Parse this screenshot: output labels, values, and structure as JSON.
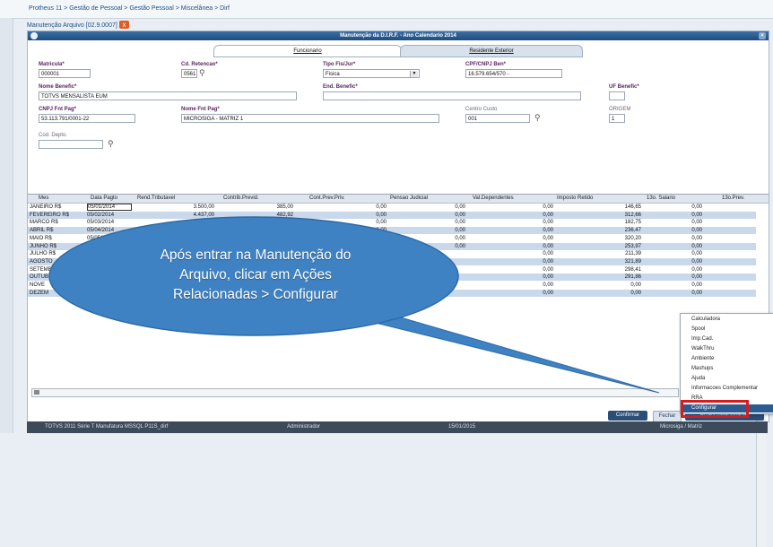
{
  "breadcrumb": "Protheus 11 > Gestão de Pessoal > Gestão Pessoal > Miscelânea > Dirf",
  "page_title": "Manutenção Arquivo [02.9.0007]",
  "close_label": "x",
  "window_title": "Manutenção da D.I.R.F. - Ano Calendario 2014",
  "tabs": [
    "Funcionario",
    "Residente Exterior"
  ],
  "fields": {
    "matricula": {
      "label": "Matricula*",
      "value": "000001"
    },
    "cd_retencao": {
      "label": "Cd. Retencao*",
      "value": "0561"
    },
    "tipo_fis_jur": {
      "label": "Tipo Fis/Jur*",
      "value": "Fisica"
    },
    "cpf_cnpj": {
      "label": "CPF/CNPJ Ben*",
      "value": "16.579.654/570 -"
    },
    "nome_benefic": {
      "label": "Nome Benefic*",
      "value": "TOTVS MENSALISTA EUM"
    },
    "end_benefic": {
      "label": "End. Benefic*",
      "value": ""
    },
    "uf_benefic": {
      "label": "UF Benefic*",
      "value": ""
    },
    "cnpj_fnt_pag": {
      "label": "CNPJ Fnt Pag*",
      "value": "53.113.791/0001-22"
    },
    "nome_fnt_pag": {
      "label": "Nome Fnt Pag*",
      "value": "MICROSIGA - MATRIZ 1"
    },
    "centro_custo": {
      "label": "Centro Custo",
      "value": "001"
    },
    "origem": {
      "label": "ORIGEM",
      "value": "1"
    },
    "cod_depto": {
      "label": "Cod. Depto.",
      "value": ""
    }
  },
  "grid": {
    "columns": [
      "Mes",
      "Data Pagto",
      "Rend.Tributavel",
      "Contrib.Previd.",
      "Cont.Prev.Priv.",
      "Pensao Judicial",
      "Val.Dependentes",
      "Imposto Retido",
      "13o. Salario",
      "13o.Prev."
    ],
    "rows": [
      [
        "JANEIRO  R$",
        "05/01/2014",
        "3.500,00",
        "385,00",
        "0,00",
        "0,00",
        "0,00",
        "146,65",
        "0,00"
      ],
      [
        "FEVEREIRO R$",
        "05/02/2014",
        "4.437,00",
        "482,92",
        "0,00",
        "0,00",
        "0,00",
        "312,66",
        "0,00"
      ],
      [
        "MARCO  R$",
        "05/03/2014",
        "3.770,42",
        "414,74",
        "0,00",
        "0,00",
        "0,00",
        "182,75",
        "0,00"
      ],
      [
        "ABRIL  R$",
        "05/04/2014",
        "",
        "",
        "0,00",
        "0,00",
        "0,00",
        "236,47",
        "0,00"
      ],
      [
        "MAIO  R$",
        "05/05/2014",
        "",
        "",
        "",
        "0,00",
        "0,00",
        "320,20",
        "0,00"
      ],
      [
        "JUNHO  R$",
        "05/",
        "",
        "",
        "",
        "0,00",
        "0,00",
        "253,97",
        "0,00"
      ],
      [
        "JULHO  R$",
        "05/",
        "",
        "",
        "",
        "",
        "0,00",
        "211,39",
        "0,00"
      ],
      [
        "AGOSTO",
        "",
        "",
        "",
        "",
        "",
        "0,00",
        "321,89",
        "0,00"
      ],
      [
        "SETEMB",
        "",
        "",
        "",
        "",
        "",
        "0,00",
        "298,41",
        "0,00"
      ],
      [
        "OUTUB",
        "",
        "",
        "",
        "",
        "",
        "0,00",
        "291,86",
        "0,00"
      ],
      [
        "NOVE",
        "",
        "",
        "",
        "",
        "",
        "0,00",
        "0,00",
        "0,00"
      ],
      [
        "DEZEM",
        "",
        "",
        "",
        "",
        "",
        "0,00",
        "0,00",
        "0,00"
      ]
    ]
  },
  "menu_items": [
    "Calculadora",
    "Spool",
    "Imp.Cad.",
    "WalkThru",
    "Ambiente",
    "Mashups",
    "Ajuda",
    "Informacoes Complementar",
    "RRA",
    "Configurar"
  ],
  "buttons": {
    "confirm": "Confirmar",
    "close": "Fechar",
    "actions": "Ações Relacionadas"
  },
  "statusbar": {
    "left": "TOTVS 2011 Série T Manufatura MSSQL P11S_dirf",
    "user": "Administrador",
    "date": "15/01/2015",
    "company": "Microsiga / Matriz"
  },
  "callout_lines": [
    "Após entrar na Manutenção do",
    "Arquivo, clicar em Ações",
    "Relacionadas > Configurar"
  ],
  "colors": {
    "accent": "#2b5b90",
    "callout": "#3f82c3",
    "highlight": "#d41e1e"
  }
}
